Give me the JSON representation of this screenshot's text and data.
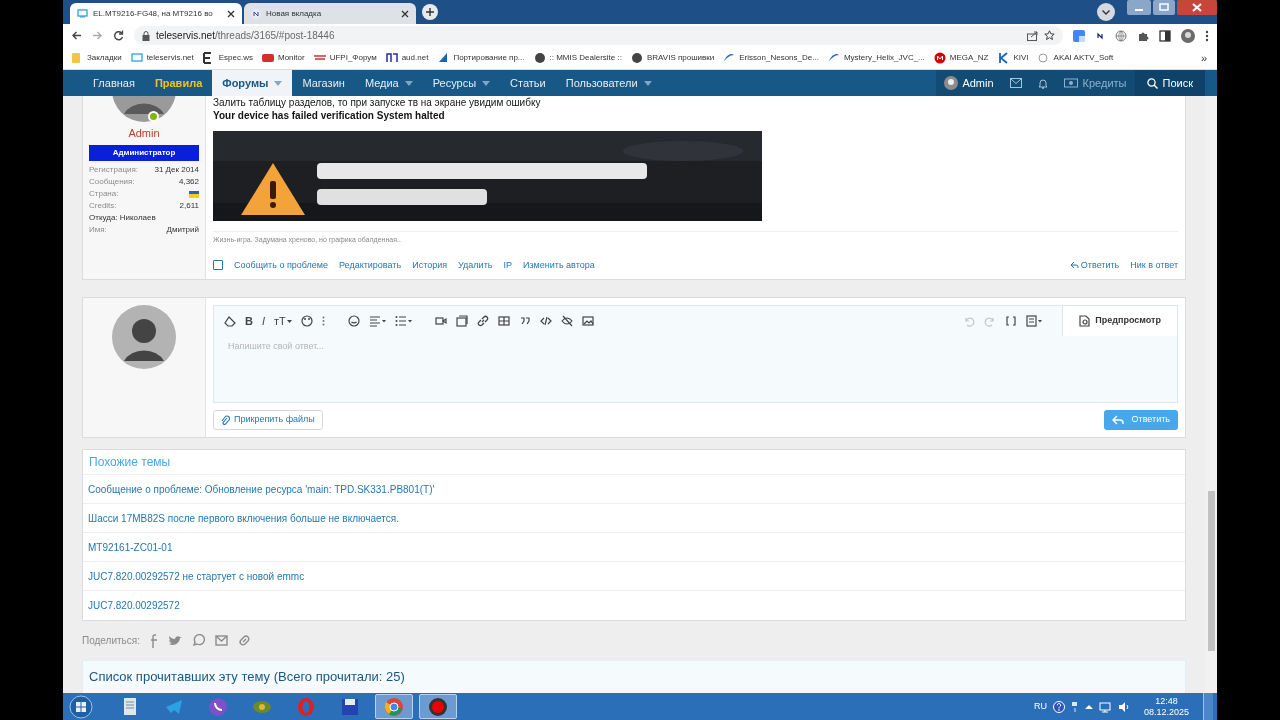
{
  "browser": {
    "tabs": [
      {
        "title": "EL.MT9216-FG48, на MT9216 во",
        "selected": true
      },
      {
        "title": "Новая вкладка",
        "selected": false
      }
    ],
    "address": {
      "host": "teleservis.net",
      "path": "/threads/3165/#post-18446"
    },
    "bookmarks": [
      "Закладки",
      "teleservis.net",
      "Espec.ws",
      "Monitor",
      "UFPI_Форум",
      "aud.net",
      "Портирование пр...",
      ":: MMIS Dealersite ::",
      "BRAVIS прошивки",
      "Erisson_Nesons_De...",
      "Mystery_Helix_JVC_...",
      "MEGA_NZ",
      "KIVI",
      "AKAI AKTV_Soft"
    ],
    "bookmarks_more": "»"
  },
  "nav": {
    "items": [
      {
        "label": "Главная",
        "selected": false,
        "dropdown": false,
        "kind": "plain"
      },
      {
        "label": "Правила",
        "selected": false,
        "dropdown": false,
        "kind": "highlight"
      },
      {
        "label": "Форумы",
        "selected": true,
        "dropdown": true,
        "kind": "plain"
      },
      {
        "label": "Магазин",
        "selected": false,
        "dropdown": false,
        "kind": "plain"
      },
      {
        "label": "Медиа",
        "selected": false,
        "dropdown": true,
        "kind": "plain"
      },
      {
        "label": "Ресурсы",
        "selected": false,
        "dropdown": true,
        "kind": "plain"
      },
      {
        "label": "Статьи",
        "selected": false,
        "dropdown": false,
        "kind": "plain"
      },
      {
        "label": "Пользователи",
        "selected": false,
        "dropdown": true,
        "kind": "plain"
      }
    ],
    "user": "Admin",
    "credits": "Кредиты",
    "search": "Поиск"
  },
  "post": {
    "author": {
      "name": "Admin",
      "role": "Администратор",
      "online": true,
      "stats": [
        {
          "kind": "pair",
          "label": "Регистрация:",
          "value": "31 Дек 2014"
        },
        {
          "kind": "pair",
          "label": "Сообщения:",
          "value": "4,362"
        },
        {
          "kind": "flag",
          "label": "Страна:"
        },
        {
          "kind": "pair",
          "label": "Credits:",
          "value": "2,611"
        },
        {
          "kind": "line",
          "label": "Откуда: Николаев"
        },
        {
          "kind": "pair",
          "label": "Имя:",
          "value": "Дмитрий"
        }
      ]
    },
    "lines": [
      {
        "text": "Залить таблицу разделов, то при запуске тв на экране увидим ошибку",
        "bold": false
      },
      {
        "text": "Your device has failed verification System halted",
        "bold": true
      }
    ],
    "checkbox": {
      "checked": false
    },
    "signature": "Жизнь-игра. Задумана хреново, но графика обалденная..",
    "actions": [
      "Сообщить о проблеме",
      "Редактировать",
      "История",
      "Удалить",
      "IP",
      "Изменить автора"
    ],
    "reply_actions": [
      "Ответить",
      "Ник в ответ"
    ]
  },
  "editor": {
    "text_buttons": [
      "B",
      "I",
      "тT"
    ],
    "placeholder": "Напишите свой ответ...",
    "preview": "Предпросмотр",
    "attach": "Прикрепить файлы",
    "submit": "Ответить"
  },
  "similar": {
    "title": "Похожие темы",
    "items": [
      "Сообщение о проблеме: Обновление ресурса 'main: TPD.SK331.PB801(T)'",
      "Шасси 17MB82S после первого включения больше не включается.",
      "MT92161-ZC01-01",
      "JUC7.820.00292572 не стартует с новой emmc",
      "JUC7.820.00292572"
    ]
  },
  "share": {
    "label": "Поделиться:"
  },
  "readers": {
    "title": "Список прочитавших эту тему (Всего прочитали: 25)"
  },
  "taskbar": {
    "language": "RU",
    "time": "12:48",
    "date": "08.12.2025"
  }
}
